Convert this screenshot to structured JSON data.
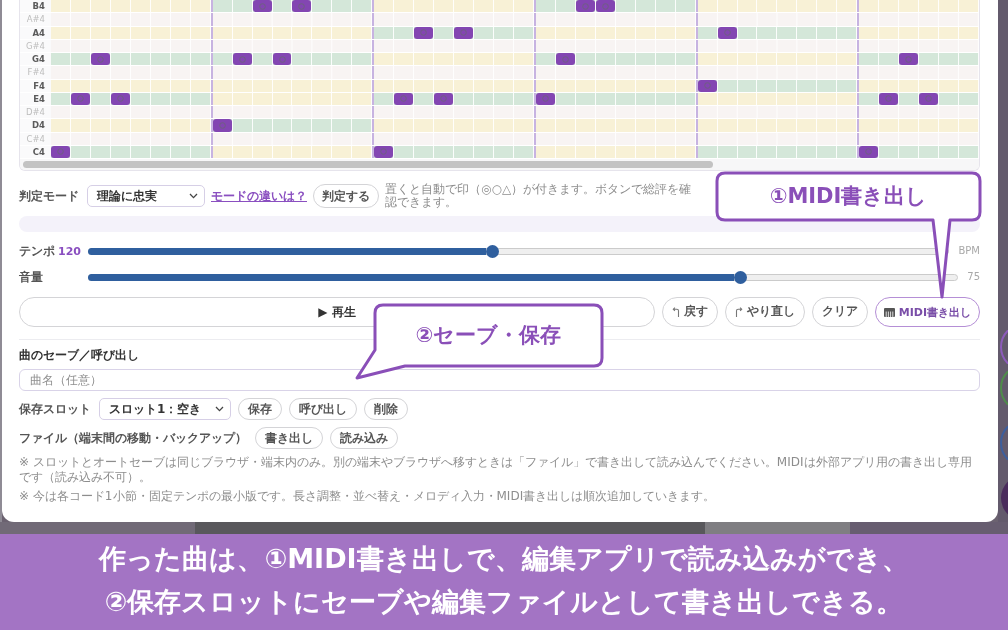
{
  "piano_roll": {
    "rows": [
      {
        "label": "B4",
        "kind": "natural",
        "bars": [
          {
            "chord_tone": false,
            "notes": [
              false,
              false,
              false,
              false,
              false,
              false,
              false,
              false
            ]
          },
          {
            "chord_tone": true,
            "notes": [
              false,
              false,
              true,
              false,
              true,
              false,
              false,
              false
            ]
          },
          {
            "chord_tone": false,
            "notes": [
              false,
              false,
              false,
              false,
              false,
              false,
              false,
              false
            ]
          },
          {
            "chord_tone": true,
            "notes": [
              false,
              false,
              true,
              true,
              false,
              false,
              false,
              false
            ]
          },
          {
            "chord_tone": false,
            "notes": [
              false,
              false,
              false,
              false,
              false,
              false,
              false,
              false
            ]
          },
          {
            "chord_tone": false,
            "notes": [
              false,
              false,
              false,
              false,
              false,
              false
            ]
          }
        ]
      },
      {
        "label": "A#4",
        "kind": "sharp"
      },
      {
        "label": "A4",
        "kind": "natural",
        "bars": [
          {
            "chord_tone": false,
            "notes": [
              false,
              false,
              false,
              false,
              false,
              false,
              false,
              false
            ]
          },
          {
            "chord_tone": false,
            "notes": [
              false,
              false,
              false,
              false,
              false,
              false,
              false,
              false
            ]
          },
          {
            "chord_tone": true,
            "notes": [
              false,
              false,
              true,
              false,
              true,
              false,
              false,
              false
            ]
          },
          {
            "chord_tone": false,
            "notes": [
              false,
              false,
              false,
              false,
              false,
              false,
              false,
              false
            ]
          },
          {
            "chord_tone": true,
            "notes": [
              false,
              true,
              false,
              false,
              false,
              false,
              false,
              false
            ]
          },
          {
            "chord_tone": false,
            "notes": [
              false,
              false,
              false,
              false,
              false,
              false
            ]
          }
        ]
      },
      {
        "label": "G#4",
        "kind": "sharp"
      },
      {
        "label": "G4",
        "kind": "natural",
        "bars": [
          {
            "chord_tone": true,
            "notes": [
              false,
              false,
              true,
              false,
              false,
              false,
              false,
              false
            ]
          },
          {
            "chord_tone": true,
            "notes": [
              false,
              true,
              false,
              true,
              false,
              false,
              false,
              false
            ]
          },
          {
            "chord_tone": false,
            "notes": [
              false,
              false,
              false,
              false,
              false,
              false,
              false,
              false
            ]
          },
          {
            "chord_tone": true,
            "notes": [
              false,
              true,
              false,
              false,
              false,
              false,
              false,
              false
            ]
          },
          {
            "chord_tone": false,
            "notes": [
              false,
              false,
              false,
              false,
              false,
              false,
              false,
              false
            ]
          },
          {
            "chord_tone": true,
            "notes": [
              false,
              false,
              true,
              false,
              false,
              false
            ]
          }
        ]
      },
      {
        "label": "F#4",
        "kind": "sharp"
      },
      {
        "label": "F4",
        "kind": "natural",
        "bars": [
          {
            "chord_tone": false,
            "notes": [
              false,
              false,
              false,
              false,
              false,
              false,
              false,
              false
            ]
          },
          {
            "chord_tone": false,
            "notes": [
              false,
              false,
              false,
              false,
              false,
              false,
              false,
              false
            ]
          },
          {
            "chord_tone": false,
            "notes": [
              false,
              false,
              false,
              false,
              false,
              false,
              false,
              false
            ]
          },
          {
            "chord_tone": false,
            "notes": [
              false,
              false,
              false,
              false,
              false,
              false,
              false,
              false
            ]
          },
          {
            "chord_tone": true,
            "notes": [
              true,
              false,
              false,
              false,
              false,
              false,
              false,
              false
            ]
          },
          {
            "chord_tone": false,
            "notes": [
              false,
              false,
              false,
              false,
              false,
              false
            ]
          }
        ]
      },
      {
        "label": "E4",
        "kind": "natural",
        "bars": [
          {
            "chord_tone": true,
            "notes": [
              false,
              true,
              false,
              true,
              false,
              false,
              false,
              false
            ]
          },
          {
            "chord_tone": false,
            "notes": [
              false,
              false,
              false,
              false,
              false,
              false,
              false,
              false
            ]
          },
          {
            "chord_tone": true,
            "notes": [
              false,
              true,
              false,
              true,
              false,
              false,
              false,
              false
            ]
          },
          {
            "chord_tone": true,
            "notes": [
              true,
              false,
              false,
              false,
              false,
              false,
              false,
              false
            ]
          },
          {
            "chord_tone": false,
            "notes": [
              false,
              false,
              false,
              false,
              false,
              false,
              false,
              false
            ]
          },
          {
            "chord_tone": true,
            "notes": [
              false,
              true,
              false,
              true,
              false,
              false
            ]
          }
        ]
      },
      {
        "label": "D#4",
        "kind": "sharp"
      },
      {
        "label": "D4",
        "kind": "natural",
        "bars": [
          {
            "chord_tone": false,
            "notes": [
              false,
              false,
              false,
              false,
              false,
              false,
              false,
              false
            ]
          },
          {
            "chord_tone": true,
            "notes": [
              true,
              false,
              false,
              false,
              false,
              false,
              false,
              false
            ]
          },
          {
            "chord_tone": false,
            "notes": [
              false,
              false,
              false,
              false,
              false,
              false,
              false,
              false
            ]
          },
          {
            "chord_tone": false,
            "notes": [
              false,
              false,
              false,
              false,
              false,
              false,
              false,
              false
            ]
          },
          {
            "chord_tone": false,
            "notes": [
              false,
              false,
              false,
              false,
              false,
              false,
              false,
              false
            ]
          },
          {
            "chord_tone": false,
            "notes": [
              false,
              false,
              false,
              false,
              false,
              false
            ]
          }
        ]
      },
      {
        "label": "C#4",
        "kind": "sharp"
      },
      {
        "label": "C4",
        "kind": "natural",
        "bars": [
          {
            "chord_tone": true,
            "notes": [
              true,
              false,
              false,
              false,
              false,
              false,
              false,
              false
            ]
          },
          {
            "chord_tone": false,
            "notes": [
              false,
              false,
              false,
              false,
              false,
              false,
              false,
              false
            ]
          },
          {
            "chord_tone": true,
            "notes": [
              true,
              false,
              false,
              false,
              false,
              false,
              false,
              false
            ]
          },
          {
            "chord_tone": false,
            "notes": [
              false,
              false,
              false,
              false,
              false,
              false,
              false,
              false
            ]
          },
          {
            "chord_tone": true,
            "notes": [
              false,
              false,
              false,
              false,
              false,
              false,
              false,
              false
            ]
          },
          {
            "chord_tone": true,
            "notes": [
              true,
              false,
              false,
              false,
              false,
              false
            ]
          }
        ]
      }
    ]
  },
  "judge": {
    "label": "判定モード",
    "mode_select": {
      "value": "理論に忠実"
    },
    "help_link": "モードの違いは？",
    "judge_button": "判定する",
    "hint": "置くと自動で印（◎○△）が付きます。ボタンで総評を確認できます。"
  },
  "sliders": [
    {
      "label": "テンポ",
      "value": "120",
      "level": 0.47,
      "unit": "BPM"
    },
    {
      "label": "音量",
      "level": 0.75,
      "reading": "75"
    }
  ],
  "transport": {
    "play_button": "▶ 再生",
    "buttons": [
      {
        "kind": "undo",
        "label": "戻す"
      },
      {
        "kind": "redo",
        "label": "やり直し"
      },
      {
        "kind": "clear",
        "label": "クリア"
      },
      {
        "kind": "midi",
        "label": "MIDI書き出し"
      }
    ]
  },
  "save_section": {
    "title": "曲のセーブ／呼び出し",
    "name_field": {
      "placeholder": "曲名（任意）"
    },
    "slot_row": {
      "label": "保存スロット",
      "slot_select": {
        "value": "スロット1：空き"
      },
      "buttons": [
        "保存",
        "呼び出し",
        "削除"
      ]
    },
    "file_row": {
      "label": "ファイル（端末間の移動・バックアップ）",
      "buttons": [
        "書き出し",
        "読み込み"
      ]
    },
    "notes": [
      "※ スロットとオートセーブは同じブラウザ・端末内のみ。別の端末やブラウザへ移すときは「ファイル」で書き出して読み込んでください。MIDIは外部アプリ用の書き出し専用です（読み込み不可）。",
      "※ 今は各コード1小節・固定テンポの最小版です。長さ調整・並べ替え・メロディ入力・MIDI書き出しは順次追加していきます。"
    ]
  },
  "callouts": [
    {
      "kind": "midi",
      "text": "①MIDI書き出し"
    },
    {
      "kind": "save",
      "text": "②セーブ・保存"
    }
  ],
  "caption": {
    "lines": [
      "作った曲は、①MIDI書き出しで、編集アプリで読み込みができ、",
      "②保存スロットにセーブや編集ファイルとして書き出しできる。"
    ]
  }
}
